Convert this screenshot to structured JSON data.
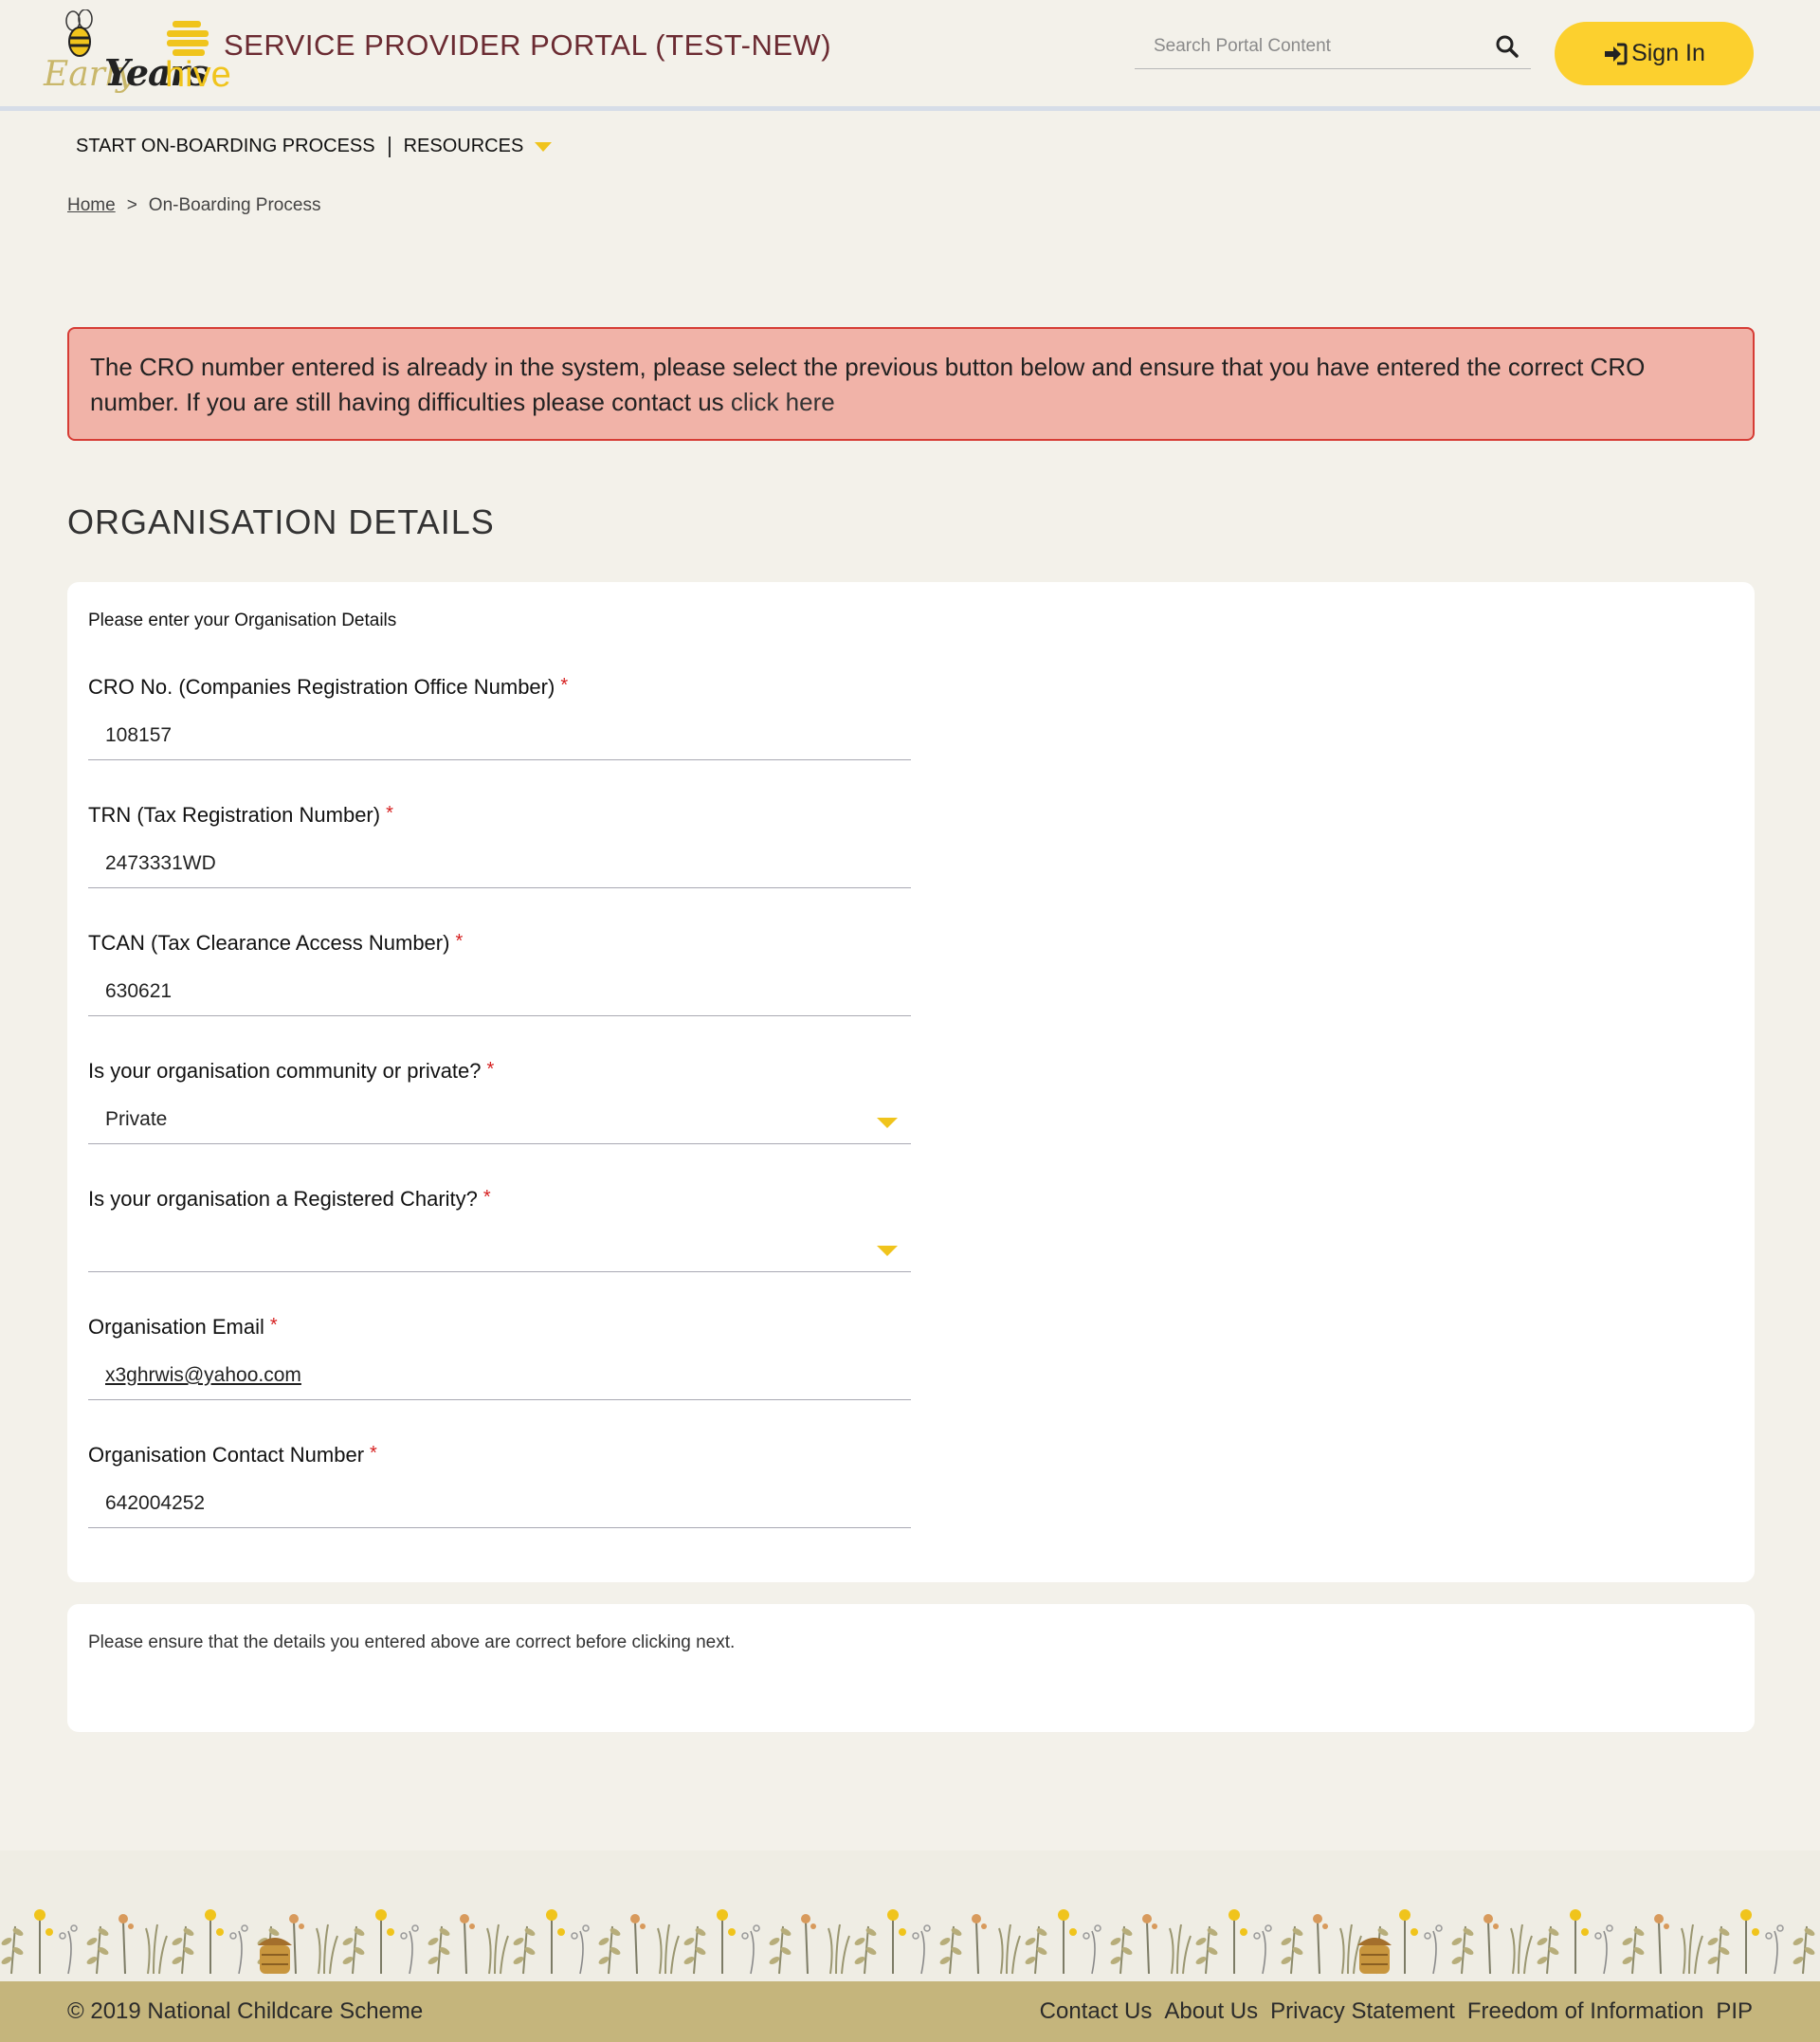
{
  "header": {
    "logo_early": "Early",
    "logo_years": "Years",
    "logo_hive": "hive",
    "portal_title": "SERVICE PROVIDER PORTAL (TEST-NEW)",
    "search_placeholder": "Search Portal Content",
    "signin_label": "Sign In"
  },
  "nav": {
    "items": [
      {
        "label": "START ON-BOARDING PROCESS"
      },
      {
        "label": "RESOURCES"
      }
    ]
  },
  "breadcrumb": {
    "home": "Home",
    "separator": ">",
    "current": "On-Boarding Process"
  },
  "alert": {
    "message": "The CRO number entered is already in the system, please select the previous button below and ensure that you have entered the correct CRO number. If you are still having difficulties please contact us",
    "link": "click here"
  },
  "section_title": "ORGANISATION DETAILS",
  "form": {
    "intro": "Please enter your Organisation Details",
    "required_mark": "*",
    "fields": [
      {
        "label": "CRO No. (Companies Registration Office Number)",
        "value": "108157"
      },
      {
        "label": "TRN (Tax Registration Number)",
        "value": "2473331WD"
      },
      {
        "label": "TCAN (Tax Clearance Access Number)",
        "value": "630621"
      },
      {
        "label": "Is your organisation community or private?",
        "value": "Private"
      },
      {
        "label": "Is your organisation a Registered Charity?",
        "value": ""
      },
      {
        "label": "Organisation Email",
        "value": "x3ghrwis@yahoo.com"
      },
      {
        "label": "Organisation Contact Number",
        "value": "642004252"
      }
    ]
  },
  "note": "Please ensure that the details you entered above are correct before clicking next.",
  "footer": {
    "copyright": "© 2019 National Childcare Scheme",
    "links": [
      "Contact Us",
      "About Us",
      "Privacy Statement",
      "Freedom of Information",
      "PIP"
    ]
  },
  "colors": {
    "accent": "#fcd02e",
    "brand_title": "#6b2b32",
    "alert_bg": "#f1b3a8",
    "alert_border": "#d63c35",
    "footer_bg": "#c5b57c"
  }
}
